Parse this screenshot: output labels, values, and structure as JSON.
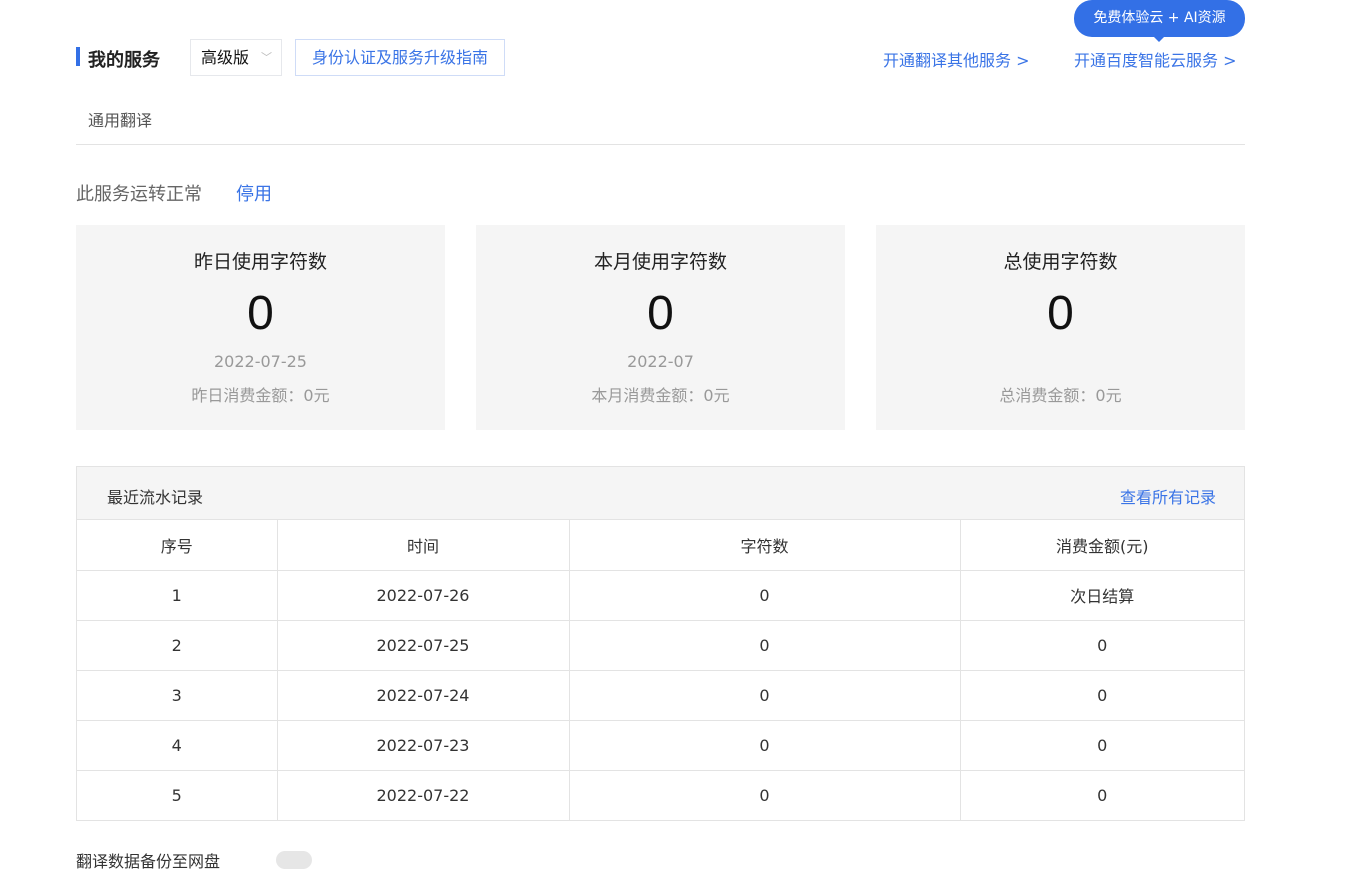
{
  "header": {
    "title": "我的服务",
    "plan": "高级版",
    "guide": "身份认证及服务升级指南",
    "link_other": "开通翻译其他服务 >",
    "link_cloud": "开通百度智能云服务 >",
    "bubble": "免费体验云 + AI资源"
  },
  "tab": "通用翻译",
  "status": {
    "text": "此服务运转正常",
    "stop": "停用"
  },
  "cards": [
    {
      "title": "昨日使用字符数",
      "value": "0",
      "date": "2022-07-25",
      "money": "昨日消费金额：0元"
    },
    {
      "title": "本月使用字符数",
      "value": "0",
      "date": "2022-07",
      "money": "本月消费金额：0元"
    },
    {
      "title": "总使用字符数",
      "value": "0",
      "date": "",
      "money": "总消费金额：0元"
    }
  ],
  "records": {
    "title": "最近流水记录",
    "view_all": "查看所有记录",
    "columns": [
      "序号",
      "时间",
      "字符数",
      "消费金额(元)"
    ],
    "rows": [
      [
        "1",
        "2022-07-26",
        "0",
        "次日结算"
      ],
      [
        "2",
        "2022-07-25",
        "0",
        "0"
      ],
      [
        "3",
        "2022-07-24",
        "0",
        "0"
      ],
      [
        "4",
        "2022-07-23",
        "0",
        "0"
      ],
      [
        "5",
        "2022-07-22",
        "0",
        "0"
      ]
    ]
  },
  "backup": {
    "label": "翻译数据备份至网盘",
    "enabled": false
  }
}
